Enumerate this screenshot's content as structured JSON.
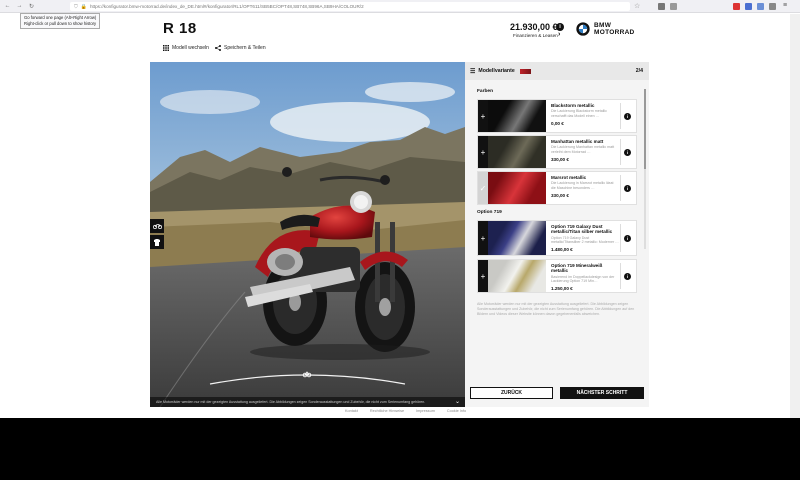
{
  "browser": {
    "url": "https://konfigurator.bmw-motorrad.de/index_de_DE.html#/konfigurator/RL1/OPT611/SB5BC/OPT48,SB748,SB96A,SB9HA/COLOUR/2",
    "tooltip_line1": "Go forward one page (Alt+Right Arrow)",
    "tooltip_line2": "Right-click or pull down to show history"
  },
  "header": {
    "model_title": "R 18",
    "change_model_label": "Modell wechseln",
    "save_share_label": "Speichern & Teilen",
    "price": "21.930,00 €",
    "finance_label": "Finanzieren & Leasen",
    "brand_line1": "BMW",
    "brand_line2": "MOTORRAD"
  },
  "stage": {
    "footnote": "Alle Motorräder werden nur mit der gezeigten Ausstattung ausgeliefert. Die Abbildungen zeigen Sonderausstattungen und Zubehör, die nicht zum Serienumfang gehören."
  },
  "panel": {
    "title": "Modellvariante",
    "step": "2/4",
    "section_colors": "Farben",
    "section_option": "Option 719",
    "options": [
      {
        "name": "Blackstorm metallic",
        "desc": "Die Lackierung Blackstorm metallic verschafft das Modell einen …",
        "price": "0,00 €"
      },
      {
        "name": "Manhattan metallic matt",
        "desc": "Die Lackierung Manhattan metallic matt verleiht dem Motorrad …",
        "price": "330,00 €"
      },
      {
        "name": "Marsrot metallic",
        "desc": "Die Lackierung in Marsrot metallic lässt die Maschine besonders …",
        "price": "330,00 €"
      },
      {
        "name": "Option 719 Galaxy Dust metallic/Titan silber metallic",
        "desc": "Option 719 Galaxy Dust metallic/Titansilber 2 metallic: Moderner …",
        "price": "1.480,00 €"
      },
      {
        "name": "Option 719 Mineralweiß metallic",
        "desc": "Basierend im Doppellackdesign von der Lackierung Option 719 Min…",
        "price": "1.250,00 €"
      }
    ],
    "note": "Alle Motorräder werden nur mit der gezeigten Ausstattung ausgeliefert. Die Abbildungen zeigen Sonderausstattungen und Zubehör, die nicht zum Serienumfang gehören. Die Abbildungen auf den Bildern und Videos dieser Website können davon gegebenenfalls abweichen.",
    "back_label": "ZURÜCK",
    "next_label": "NÄCHSTER SCHRITT"
  },
  "footer": {
    "links": [
      "Kontakt",
      "Rechtliche Hinweise",
      "Impressum",
      "Cookie Info"
    ]
  },
  "colors": {
    "accent": "#111111",
    "red_bike": "#b21e24"
  }
}
